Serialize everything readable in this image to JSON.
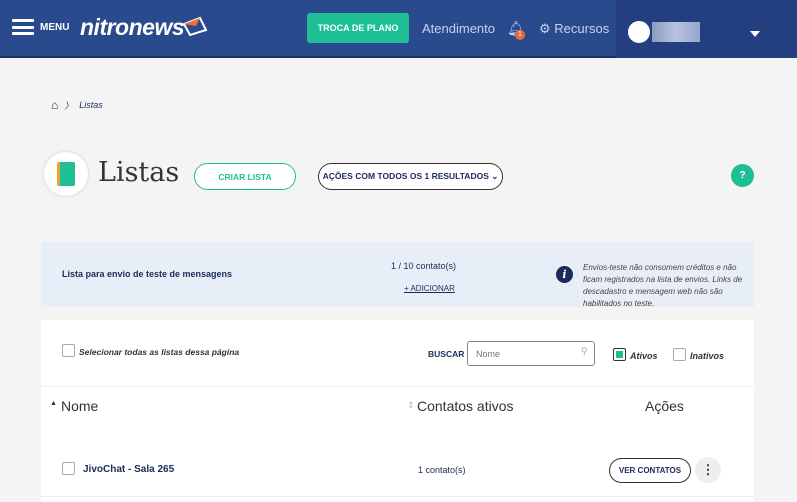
{
  "header": {
    "menu_label": "MENU",
    "logo": "nitronews",
    "plan_button": "TROCA DE PLANO",
    "support": "Atendimento",
    "notifications": "1",
    "resources": "Recursos"
  },
  "breadcrumb": {
    "current": "Listas"
  },
  "page": {
    "title": "Listas",
    "create_button": "CRIAR LISTA",
    "bulk_actions": "AÇÕES COM TODOS OS 1 RESULTADOS",
    "help": "?"
  },
  "test_list": {
    "name": "Lista para envio de teste de mensagens",
    "count": "1 / 10 contato(s)",
    "add": "+ ADICIONAR",
    "info": "Envios-teste não consomem créditos e não ficam registrados na lista de envios. Links de descadastro e mensagem web não são habilitados no teste."
  },
  "filters": {
    "select_all": "Selecionar todas as listas dessa página",
    "search_label": "BUSCAR",
    "search_placeholder": "Nome",
    "active": "Ativos",
    "inactive": "Inativos"
  },
  "table": {
    "headers": [
      "Nome",
      "Contatos ativos",
      "Ações"
    ],
    "rows": [
      {
        "name": "JivoChat - Sala 265",
        "contacts": "1 contato(s)",
        "action": "VER CONTATOS"
      }
    ]
  },
  "colors": {
    "accent": "#1fbf96",
    "header": "#2a4a8e"
  }
}
